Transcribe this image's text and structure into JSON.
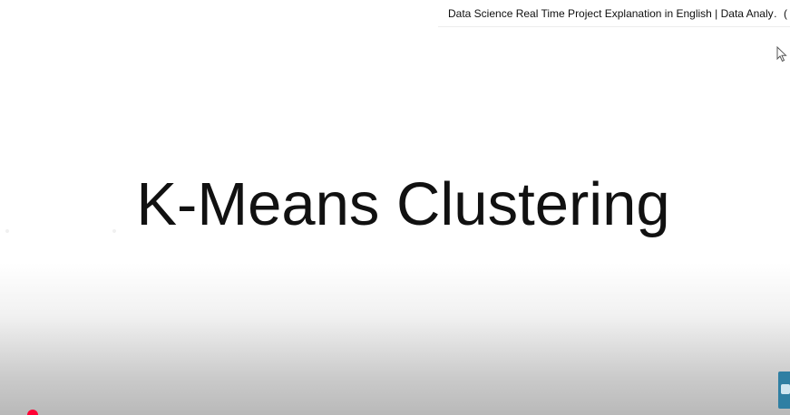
{
  "slide": {
    "title": "K-Means Clustering"
  },
  "suggestion": {
    "video_title": "Data Science Real Time Project Explanation in English | Data Analy…",
    "extra": "("
  },
  "icons": {
    "cursor": "mouse-pointer-icon",
    "thumbnail": "thumbnail-icon",
    "scrubber": "progress-scrubber-icon"
  },
  "colors": {
    "scrubber": "#ff0033",
    "thumbnail": "#2f7fa3"
  }
}
